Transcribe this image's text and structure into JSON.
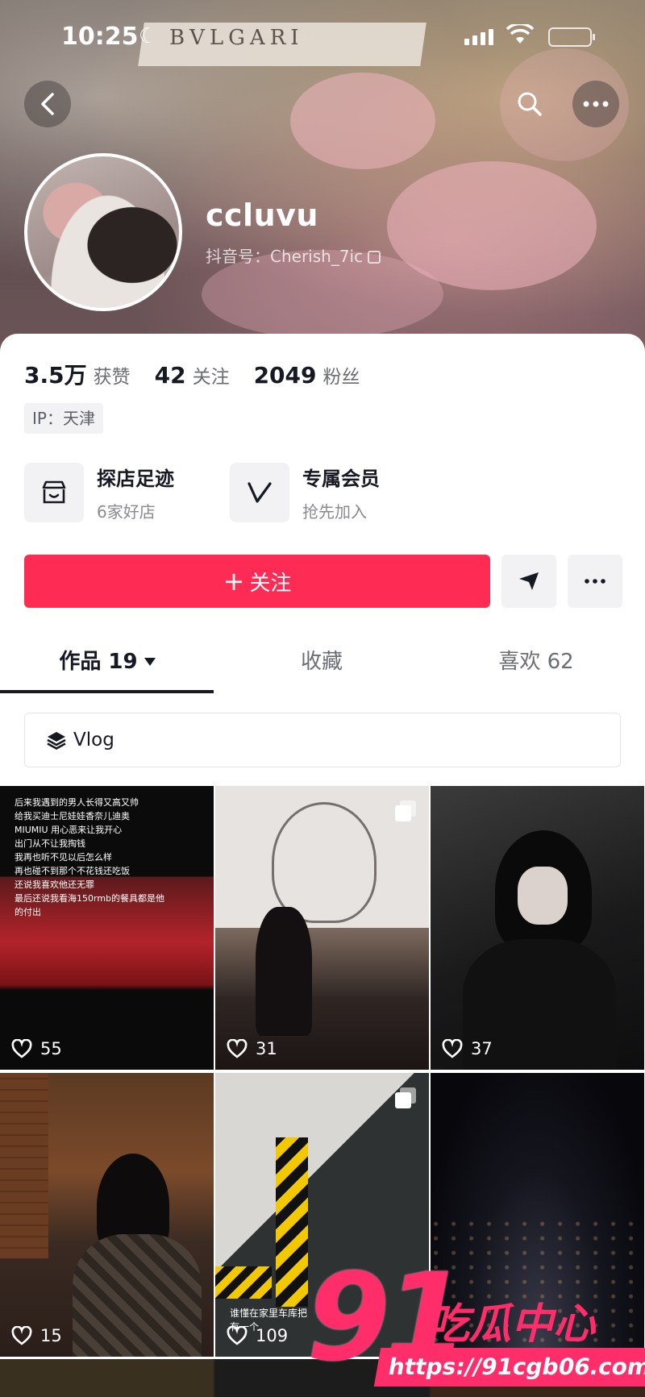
{
  "status_bar": {
    "time": "10:25"
  },
  "cover": {
    "brand_sign": "BVLGARI"
  },
  "profile": {
    "username": "ccluvu",
    "douyin_id": "抖音号：Cherish_7ic",
    "stats": [
      {
        "value": "3.5万",
        "label": "获赞"
      },
      {
        "value": "42",
        "label": "关注"
      },
      {
        "value": "2049",
        "label": "粉丝"
      }
    ],
    "ip": "IP：天津"
  },
  "features": [
    {
      "title": "探店足迹",
      "subtitle": "6家好店",
      "icon": "shop-icon"
    },
    {
      "title": "专属会员",
      "subtitle": "抢先加入",
      "icon": "v-member-icon"
    }
  ],
  "actions": {
    "follow_label": "关注"
  },
  "tabs": [
    {
      "label": "作品 19",
      "active": true
    },
    {
      "label": "收藏",
      "active": false
    },
    {
      "label": "喜欢 62",
      "active": false
    }
  ],
  "collection": {
    "label": "Vlog"
  },
  "videos": [
    {
      "likes": "55",
      "multi": false
    },
    {
      "likes": "31",
      "multi": true
    },
    {
      "likes": "37",
      "multi": false
    },
    {
      "likes": "15",
      "multi": false
    },
    {
      "likes": "109",
      "multi": true
    },
    {
      "likes": "",
      "multi": false
    }
  ],
  "video_captions": {
    "first": [
      "后来我遇到的男人长得又高又帅",
      "给我买迪士尼娃娃香奈儿迪奥",
      "MIUMIU 用心恶来让我开心",
      "出门从不让我掏钱",
      "我再也听不见以后怎么样",
      "再也碰不到那个不花钱还吃饭",
      "还说我喜欢他还无罪",
      "最后还说我看海150rmb的餐具都是他",
      "的付出"
    ],
    "fifth": [
      "谁懂在家里车库把",
      "有一个"
    ]
  },
  "watermark": {
    "number": "91",
    "name": "吃瓜中心",
    "url": "https://91cgb06.com"
  },
  "colors": {
    "accent": "#fe2c55",
    "watermark": "#ff2d6a"
  }
}
